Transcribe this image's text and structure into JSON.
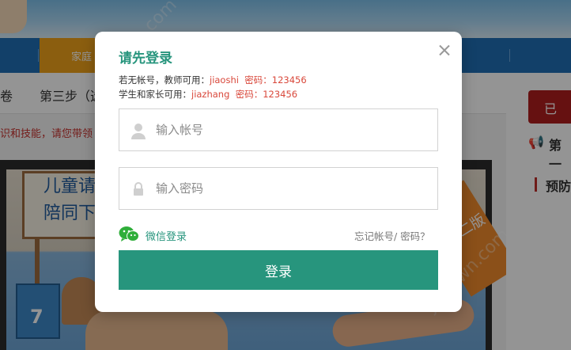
{
  "background": {
    "nav_home_label": "家庭",
    "step_a": "卷",
    "step_b": "第三步（选",
    "notice": "识和技能，请您带领",
    "sign_line1": "儿童请",
    "sign_line2": "陪同下",
    "block_number": "7",
    "ribbon_text": "二版",
    "right_btn": "已",
    "right_speaker_text": "第一",
    "right_bar_text": "预防"
  },
  "modal": {
    "title": "请先登录",
    "hint_line1_prefix": "若无帐号，教师可用：",
    "hint_line1_user": "jiaoshi",
    "hint_line1_pass_label": "密码：",
    "hint_line1_pass": "123456",
    "hint_line2_prefix": "学生和家长可用：",
    "hint_line2_user": "jiazhang",
    "hint_line2_pass_label": "密码：",
    "hint_line2_pass": "123456",
    "username": {
      "value": "",
      "placeholder": "输入帐号"
    },
    "password": {
      "value": "",
      "placeholder": "输入密码"
    },
    "wechat_login_label": "微信登录",
    "forgot_label": "忘记帐号/ 密码？",
    "login_button_label": "登录"
  },
  "icons": {
    "close": "close-icon",
    "user": "user-icon",
    "lock": "lock-icon",
    "wechat": "wechat-icon"
  },
  "colors": {
    "accent": "#27957d",
    "hint_highlight": "#d9483b",
    "nav_blue": "#1f6fb5",
    "nav_orange": "#f0a21a",
    "right_red": "#b01e1e"
  },
  "watermark": "yqdown.com"
}
